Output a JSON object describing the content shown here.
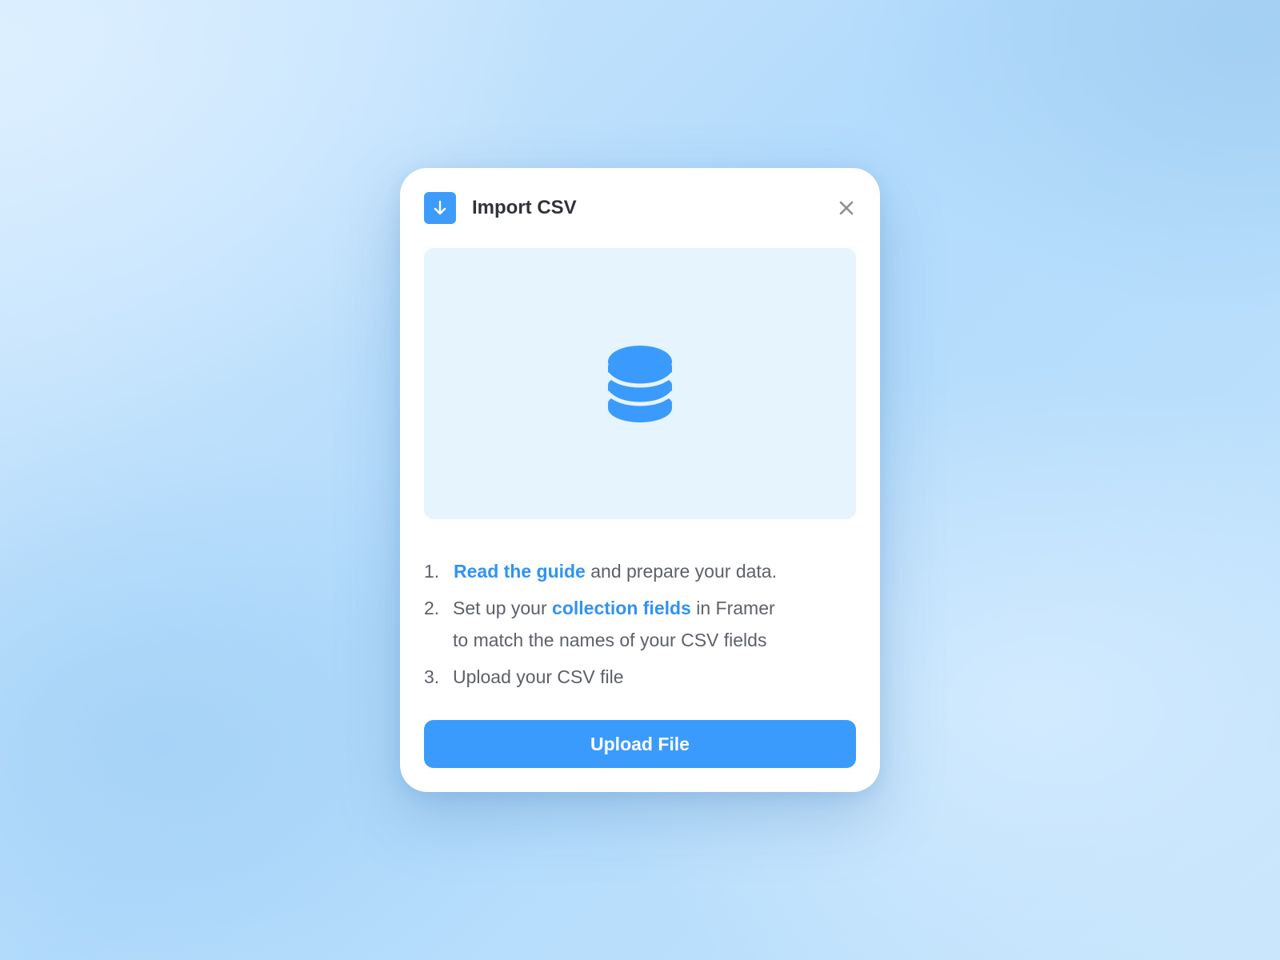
{
  "dialog": {
    "title": "Import CSV",
    "header_icon": "arrow-down-icon",
    "close_icon": "close-icon",
    "preview_icon": "database-icon",
    "steps": [
      {
        "number": "1.",
        "link": "Read the guide",
        "after": " and prepare your data."
      },
      {
        "number": "2.",
        "before": "Set up your ",
        "link": "collection fields",
        "after_line1": " in Framer",
        "line2": "to match the names of your CSV fields"
      },
      {
        "number": "3.",
        "text": "Upload your CSV file"
      }
    ],
    "upload_label": "Upload File"
  },
  "colors": {
    "accent": "#3a9bfd",
    "link": "#3193f2",
    "preview_bg": "#e6f4fd",
    "text": "#5d6168",
    "title": "#303338"
  }
}
